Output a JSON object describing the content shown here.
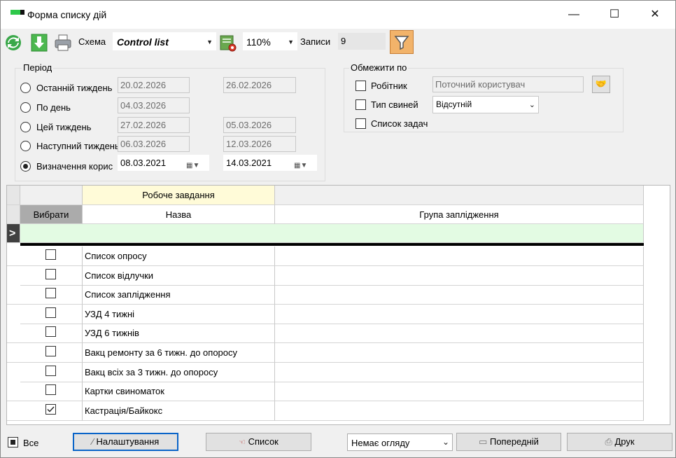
{
  "window": {
    "title": "Форма списку дій",
    "controls": [
      "—",
      "☐",
      "✕"
    ]
  },
  "toolbar": {
    "scheme_label": "Схема",
    "scheme_value": "Control list",
    "zoom_value": "110%",
    "records_label": "Записи",
    "records_value": "9",
    "colors": {
      "refresh": "#3aa84a",
      "download": "#3aa84a",
      "filter_active": "#f2b36a"
    }
  },
  "period": {
    "title": "Період",
    "options": [
      {
        "label": "Останній тиждень",
        "from": "20.02.2026",
        "to": "26.02.2026",
        "selected": false
      },
      {
        "label": "По день",
        "from": "04.03.2026",
        "to": "",
        "selected": false
      },
      {
        "label": "Цей тиждень",
        "from": "27.02.2026",
        "to": "05.03.2026",
        "selected": false
      },
      {
        "label": "Наступний тиждень",
        "from": "06.03.2026",
        "to": "12.03.2026",
        "selected": false
      },
      {
        "label": "Визначення корис",
        "from": "08.03.2021",
        "to": "14.03.2021",
        "selected": true
      }
    ]
  },
  "restrict": {
    "title": "Обмежити по",
    "worker_label": "Робітник",
    "worker_value": "Поточний користувач",
    "pig_type_label": "Тип свиней",
    "pig_type_value": "Відсутній",
    "task_list_label": "Список задач"
  },
  "grid": {
    "group_header": "Робоче завдання",
    "columns": {
      "select": "Вибрати",
      "name": "Назва",
      "group": "Група заплідження"
    },
    "current_row_marker": ">",
    "rows": [
      {
        "checked": false,
        "name": "Список опросу",
        "group": ""
      },
      {
        "checked": false,
        "name": "Список відлучки",
        "group": ""
      },
      {
        "checked": false,
        "name": "Список заплідження",
        "group": ""
      },
      {
        "checked": false,
        "name": "УЗД 4 тижні",
        "group": ""
      },
      {
        "checked": false,
        "name": "УЗД 6 тижнів",
        "group": ""
      },
      {
        "checked": false,
        "name": "Вакц ремонту за 6 тижн. до опоросу",
        "group": ""
      },
      {
        "checked": false,
        "name": "Вакц всіх за 3 тижн. до опоросу",
        "group": ""
      },
      {
        "checked": false,
        "name": "Картки свиноматок",
        "group": ""
      },
      {
        "checked": true,
        "name": "Кастрація/Байкокс",
        "group": ""
      }
    ]
  },
  "footer": {
    "all_label": "Все",
    "settings_label": "Налаштування",
    "list_label": "Список",
    "review_value": "Немає огляду",
    "prev_label": "Попередній",
    "print_label": "Друк"
  }
}
